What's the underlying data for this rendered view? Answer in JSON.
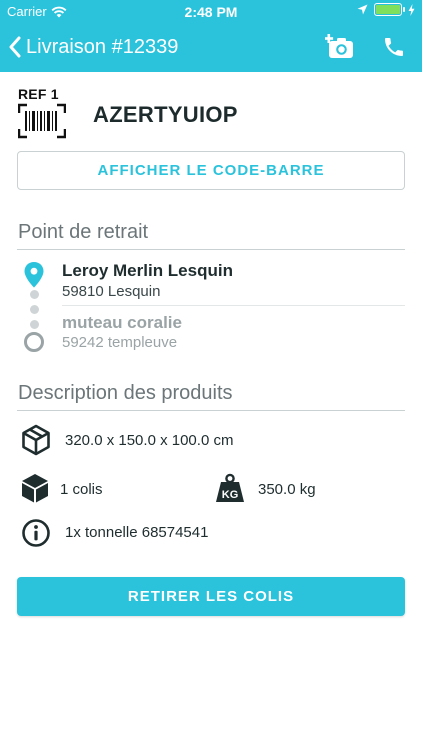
{
  "colors": {
    "accent": "#2bc3dc",
    "text": "#1f2d2f",
    "muted": "#6c7679",
    "disabled": "#9aa3a5",
    "divider": "#c9d1d3"
  },
  "status_bar": {
    "carrier": "Carrier",
    "time": "2:48 PM"
  },
  "nav": {
    "title": "Livraison #12339",
    "back_icon": "chevron-left-icon",
    "camera_icon": "add-photo-icon",
    "phone_icon": "phone-icon"
  },
  "reference": {
    "label": "REF 1",
    "icon": "barcode-scan-icon",
    "code": "AZERTYUIOP"
  },
  "barcode_button": {
    "label": "AFFICHER LE CODE-BARRE"
  },
  "pickup": {
    "title": "Point de retrait",
    "stops": [
      {
        "name": "Leroy Merlin Lesquin",
        "city": "59810 Lesquin",
        "icon": "map-pin-icon"
      },
      {
        "name": "muteau coralie",
        "city": "59242 templeuve",
        "icon": "circle-outline-icon"
      }
    ]
  },
  "products": {
    "title": "Description des produits",
    "dimensions": {
      "icon": "package-outline-icon",
      "text": "320.0 x 150.0 x 100.0 cm"
    },
    "parcels": {
      "icon": "box-icon",
      "text": "1 colis"
    },
    "weight": {
      "icon": "weight-kg-icon",
      "text": "350.0 kg"
    },
    "details": {
      "icon": "info-icon",
      "text": "1x tonnelle 68574541"
    }
  },
  "action_button": {
    "label": "RETIRER LES COLIS"
  }
}
